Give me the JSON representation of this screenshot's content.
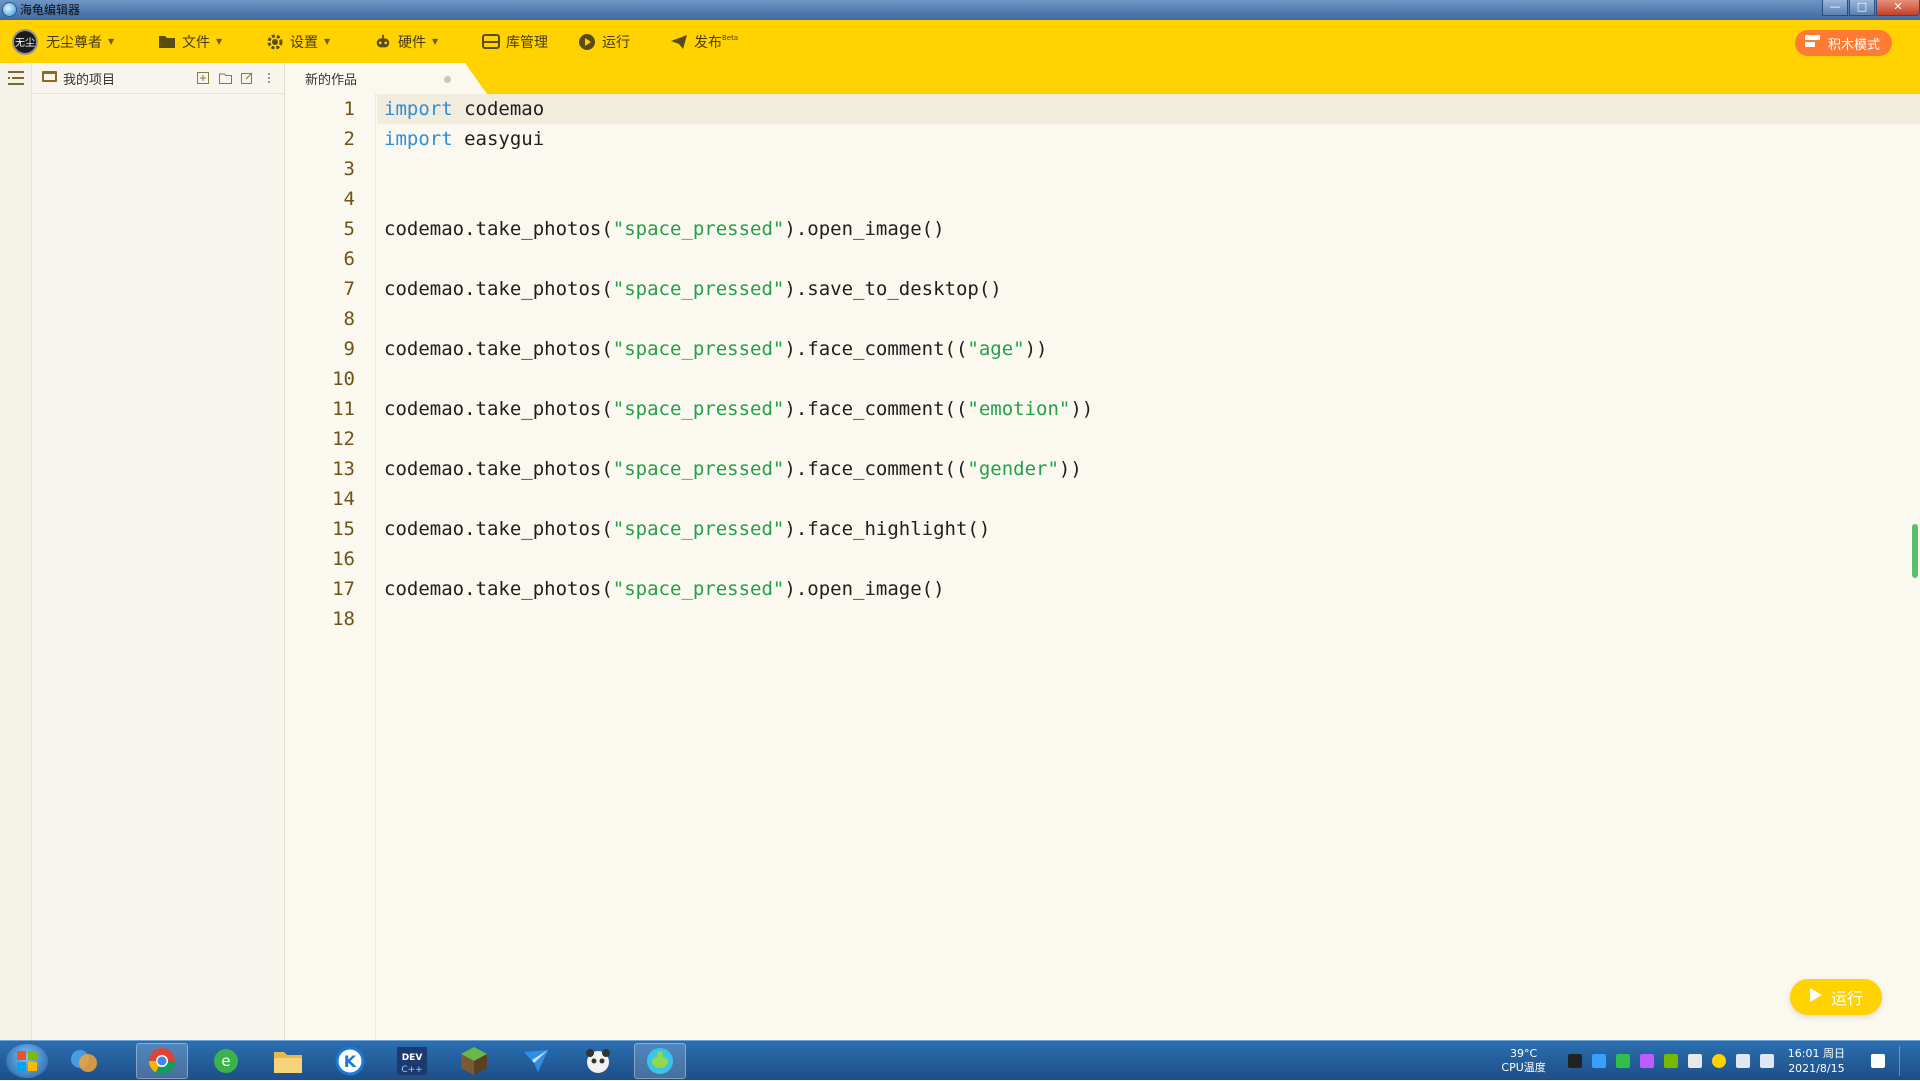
{
  "window": {
    "title": "海龟编辑器",
    "min": "—",
    "max": "□",
    "close": "✕"
  },
  "toolbar": {
    "user": {
      "avatar_text": "无尘",
      "label": "无尘尊者"
    },
    "file": "文件",
    "settings": "设置",
    "hardware": "硬件",
    "library": "库管理",
    "run": "运行",
    "publish": "发布",
    "publish_badge": "Beta",
    "block_mode": "积木模式"
  },
  "project_panel": {
    "title": "我的项目"
  },
  "tab": {
    "label": "新的作品"
  },
  "editor": {
    "lines": [
      {
        "n": "1",
        "tokens": [
          {
            "t": "import",
            "c": "kw"
          },
          {
            "t": " codemao",
            "c": ""
          }
        ]
      },
      {
        "n": "2",
        "tokens": [
          {
            "t": "import",
            "c": "kw"
          },
          {
            "t": " easygui",
            "c": ""
          }
        ]
      },
      {
        "n": "3",
        "tokens": []
      },
      {
        "n": "4",
        "tokens": []
      },
      {
        "n": "5",
        "tokens": [
          {
            "t": "codemao.take_photos(",
            "c": ""
          },
          {
            "t": "\"space_pressed\"",
            "c": "str"
          },
          {
            "t": ").open_image()",
            "c": ""
          }
        ]
      },
      {
        "n": "6",
        "tokens": []
      },
      {
        "n": "7",
        "tokens": [
          {
            "t": "codemao.take_photos(",
            "c": ""
          },
          {
            "t": "\"space_pressed\"",
            "c": "str"
          },
          {
            "t": ").save_to_desktop()",
            "c": ""
          }
        ]
      },
      {
        "n": "8",
        "tokens": []
      },
      {
        "n": "9",
        "tokens": [
          {
            "t": "codemao.take_photos(",
            "c": ""
          },
          {
            "t": "\"space_pressed\"",
            "c": "str"
          },
          {
            "t": ").face_comment((",
            "c": ""
          },
          {
            "t": "\"age\"",
            "c": "str"
          },
          {
            "t": "))",
            "c": ""
          }
        ]
      },
      {
        "n": "10",
        "tokens": []
      },
      {
        "n": "11",
        "tokens": [
          {
            "t": "codemao.take_photos(",
            "c": ""
          },
          {
            "t": "\"space_pressed\"",
            "c": "str"
          },
          {
            "t": ").face_comment((",
            "c": ""
          },
          {
            "t": "\"emotion\"",
            "c": "str"
          },
          {
            "t": "))",
            "c": ""
          }
        ]
      },
      {
        "n": "12",
        "tokens": []
      },
      {
        "n": "13",
        "tokens": [
          {
            "t": "codemao.take_photos(",
            "c": ""
          },
          {
            "t": "\"space_pressed\"",
            "c": "str"
          },
          {
            "t": ").face_comment((",
            "c": ""
          },
          {
            "t": "\"gender\"",
            "c": "str"
          },
          {
            "t": "))",
            "c": ""
          }
        ]
      },
      {
        "n": "14",
        "tokens": []
      },
      {
        "n": "15",
        "tokens": [
          {
            "t": "codemao.take_photos(",
            "c": ""
          },
          {
            "t": "\"space_pressed\"",
            "c": "str"
          },
          {
            "t": ").face_highlight()",
            "c": ""
          }
        ]
      },
      {
        "n": "16",
        "tokens": []
      },
      {
        "n": "17",
        "tokens": [
          {
            "t": "codemao.take_photos(",
            "c": ""
          },
          {
            "t": "\"space_pressed\"",
            "c": "str"
          },
          {
            "t": ").open_image()",
            "c": ""
          }
        ]
      },
      {
        "n": "18",
        "tokens": []
      }
    ],
    "active_line": "1"
  },
  "run_button": {
    "label": "运行"
  },
  "taskbar": {
    "apps": [
      "start-orb",
      "media-app",
      "chrome",
      "ie-browser",
      "file-explorer",
      "k-app",
      "dev-cpp",
      "minecraft",
      "bird-app",
      "panda-app",
      "turtle-editor"
    ],
    "cpu_temp": "39°C",
    "cpu_label": "CPU温度",
    "time": "16:01 周日",
    "date": "2021/8/15"
  },
  "colors": {
    "toolbar": "#ffd200",
    "keyword": "#2e8ed8",
    "string": "#22a04a",
    "block_mode": "#ff7a33"
  }
}
